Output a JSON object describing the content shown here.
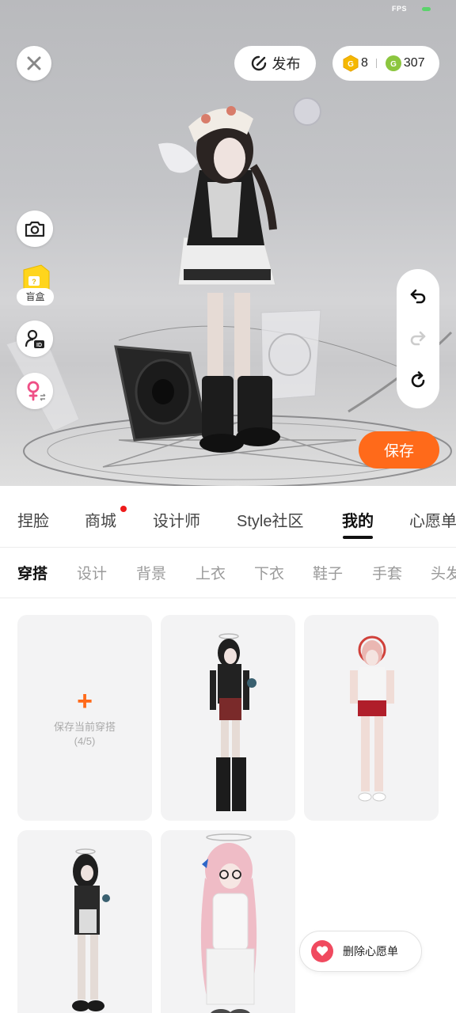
{
  "status": {
    "fps_label": "FPS"
  },
  "toolbar": {
    "publish_label": "发布",
    "gold_coins": "8",
    "green_coins": "307"
  },
  "side_tools": {
    "blind_box_label": "盲盒"
  },
  "save_label": "保存",
  "tabs": [
    {
      "label": "捏脸",
      "active": false
    },
    {
      "label": "商城",
      "active": false,
      "badge": true
    },
    {
      "label": "设计师",
      "active": false
    },
    {
      "label": "Style社区",
      "active": false
    },
    {
      "label": "我的",
      "active": true
    },
    {
      "label": "心愿单",
      "active": false
    }
  ],
  "subtabs": [
    {
      "label": "穿搭",
      "active": true
    },
    {
      "label": "设计",
      "active": false
    },
    {
      "label": "背景",
      "active": false
    },
    {
      "label": "上衣",
      "active": false
    },
    {
      "label": "下衣",
      "active": false
    },
    {
      "label": "鞋子",
      "active": false
    },
    {
      "label": "手套",
      "active": false
    },
    {
      "label": "头发",
      "active": false
    }
  ],
  "outfits": {
    "add_label": "保存当前穿搭",
    "add_count": "(4/5)"
  },
  "wishlist_remove_label": "删除心愿单",
  "colors": {
    "accent": "#ff6a1a",
    "badge": "#ee1b1b",
    "heart": "#f04a5f",
    "gold": "#f5b800",
    "green": "#8cc63f"
  }
}
